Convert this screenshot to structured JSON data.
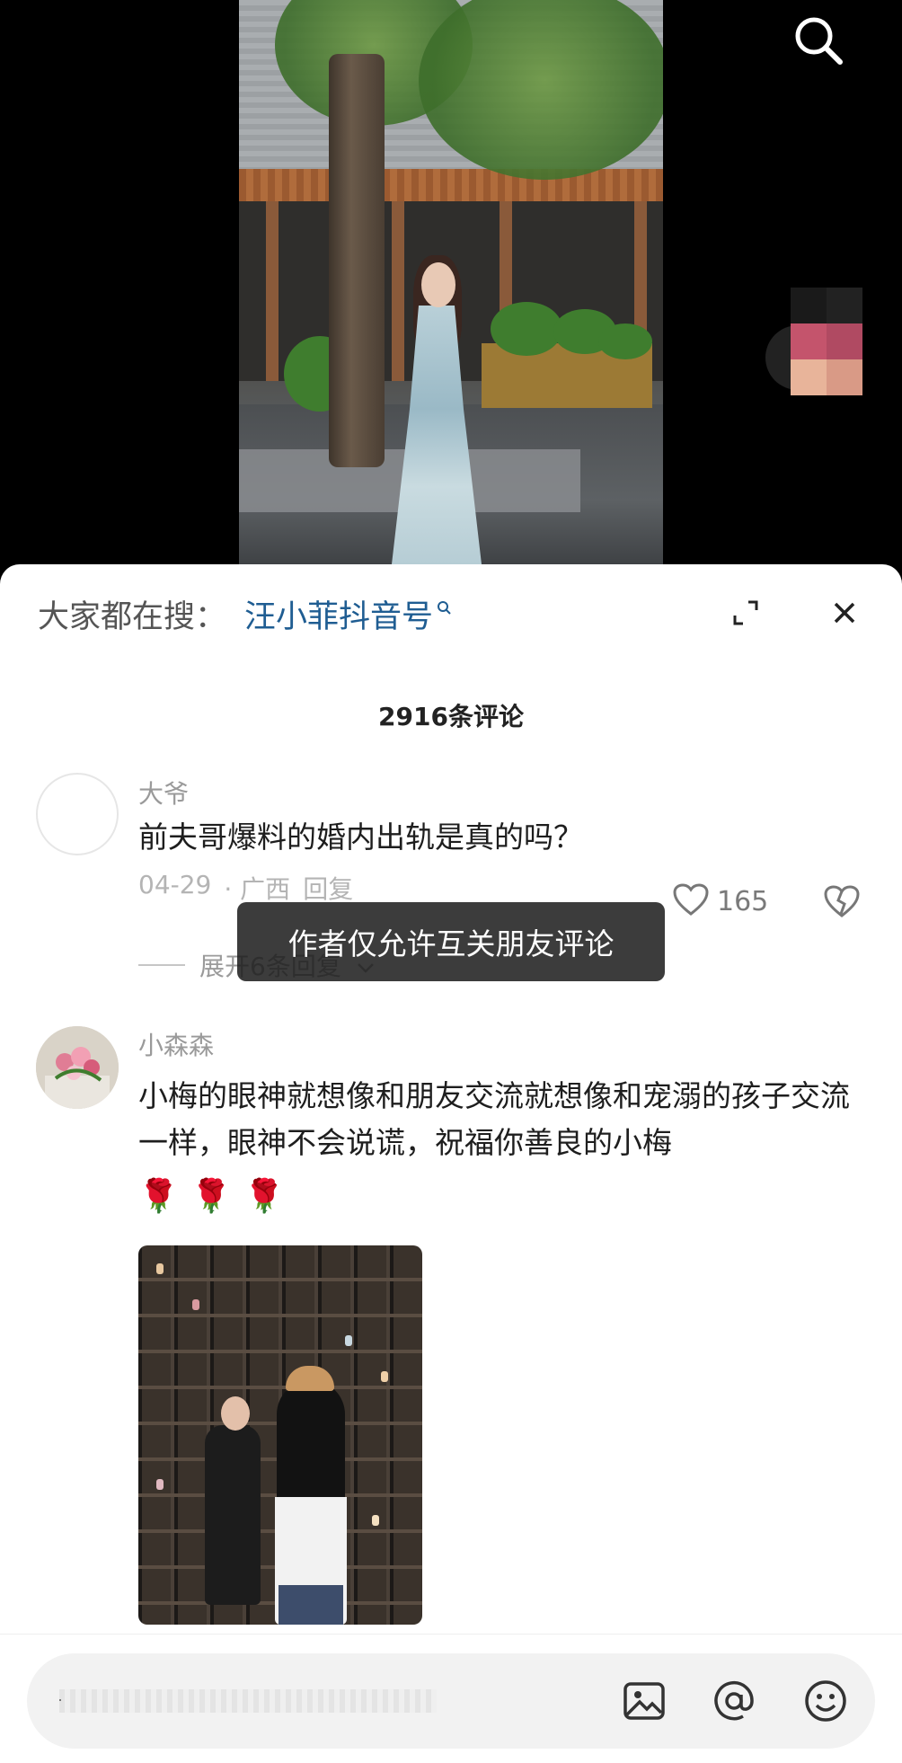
{
  "hot_search": {
    "prefix": "大家都在搜：",
    "term": "汪小菲抖音号"
  },
  "comments_header": {
    "count_label": "2916条评论"
  },
  "comments": [
    {
      "username": "大爷",
      "text": "前夫哥爆料的婚内出轨是真的吗？",
      "date": "04-29",
      "location": "· 广西",
      "reply_label": "回复",
      "like_count": "165",
      "expand_label": "展开6条回复"
    },
    {
      "username": "小森森",
      "text": "小梅的眼神就想像和朋友交流就想像和宠溺的孩子交流一样，眼神不会说谎，祝福你善良的小梅",
      "emojis": [
        "🌹",
        "🌹",
        "🌹"
      ]
    }
  ],
  "toast": {
    "message": "作者仅允许互关朋友评论"
  },
  "icons": {
    "top_search": "search-icon",
    "expand": "expand-icon",
    "close": "close-icon",
    "like": "heart-icon",
    "dislike": "broken-heart-icon",
    "image": "image-icon",
    "mention": "at-icon",
    "emoji": "emoji-icon"
  },
  "colors": {
    "hot_term": "#1f5d92",
    "sheet_bg": "#ffffff",
    "toast_bg": "#1c1c1c"
  }
}
